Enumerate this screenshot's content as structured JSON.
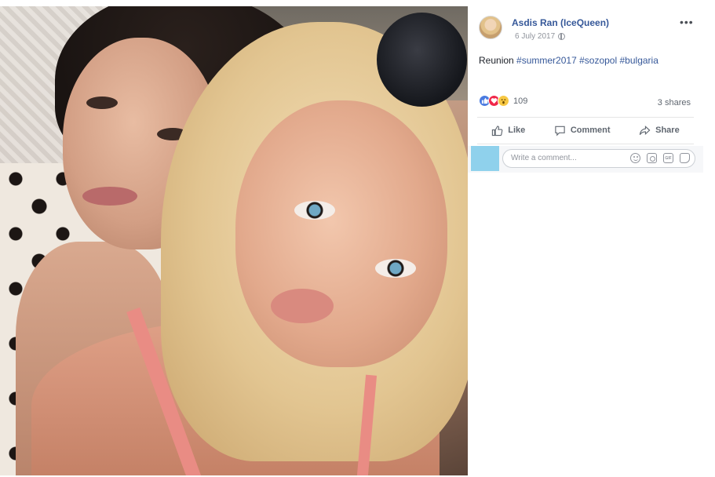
{
  "post": {
    "author": "Asdis Ran (IceQueen)",
    "date": "6 July 2017",
    "privacy_icon": "globe-icon",
    "more_label": "•••",
    "caption_text": "Reunion",
    "hashtags": [
      "#summer2017",
      "#sozopol",
      "#bulgaria"
    ],
    "reactions": {
      "icons": [
        "like",
        "love",
        "wow"
      ],
      "count": "109"
    },
    "shares": "3 shares",
    "actions": {
      "like_label": "Like",
      "comment_label": "Comment",
      "share_label": "Share"
    },
    "comment": {
      "placeholder": "Write a comment...",
      "icons": [
        "emoji-icon",
        "camera-icon",
        "gif-icon",
        "sticker-icon"
      ]
    }
  },
  "colors": {
    "link": "#365899",
    "like": "#4a7be0",
    "love": "#f0284a",
    "wow": "#f7c844",
    "comment_avatar": "#8fd1ec"
  }
}
